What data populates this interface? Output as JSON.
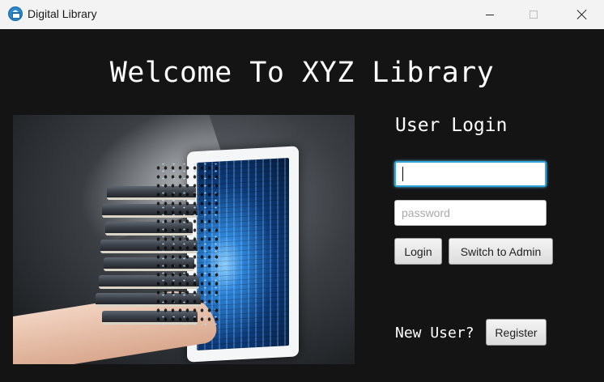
{
  "window": {
    "title": "Digital Library",
    "icon": "library-app-icon",
    "controls": [
      "minimize",
      "maximize",
      "close"
    ]
  },
  "main": {
    "heading": "Welcome To XYZ Library",
    "hero_image": "books-flowing-into-tablet"
  },
  "login": {
    "title": "User Login",
    "username_value": "",
    "password_placeholder": "password",
    "login_label": "Login",
    "switch_admin_label": "Switch to Admin",
    "new_user_text": "New User?",
    "register_label": "Register"
  },
  "colors": {
    "background": "#141414",
    "titlebar": "#f3f3f3",
    "focus_accent": "#2fa7d9",
    "text": "#ffffff"
  }
}
